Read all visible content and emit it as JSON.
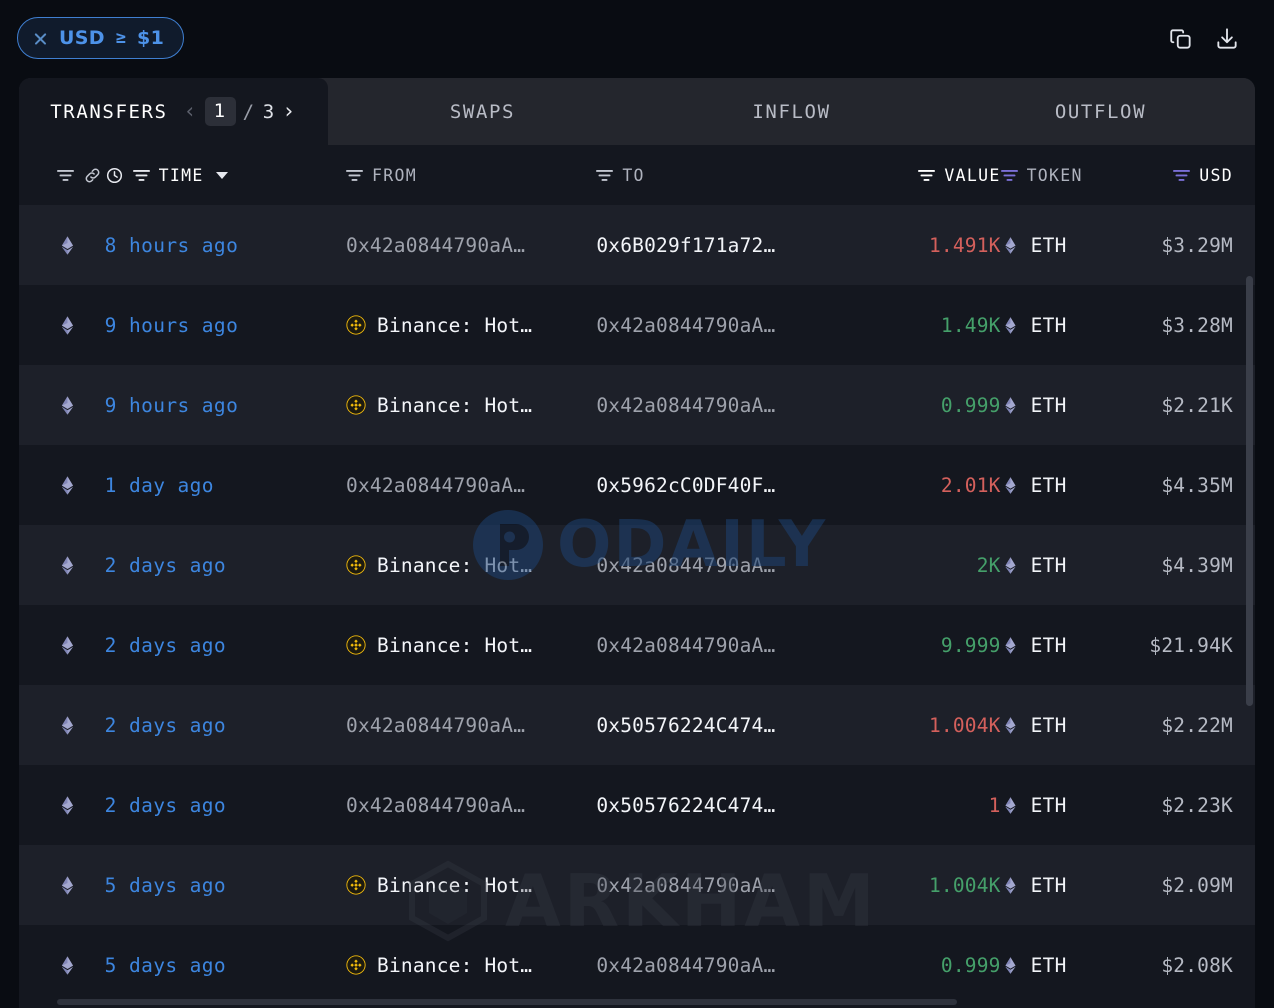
{
  "filter_chip": {
    "close_icon": "close-icon",
    "field": "USD",
    "operator": "≥",
    "value": "$1"
  },
  "toolbar": {
    "copy_icon": "copy-icon",
    "download_icon": "download-icon"
  },
  "tabs": [
    {
      "label": "TRANSFERS",
      "active": true
    },
    {
      "label": "SWAPS",
      "active": false
    },
    {
      "label": "INFLOW",
      "active": false
    },
    {
      "label": "OUTFLOW",
      "active": false
    }
  ],
  "pagination": {
    "prev_icon": "chevron-left-icon",
    "current": "1",
    "separator": "/",
    "total": "3",
    "next_icon": "chevron-right-icon"
  },
  "columns": {
    "chain_filter_icon": "filter-icon",
    "chain_link_icon": "link-icon",
    "time_clock_icon": "clock-icon",
    "time_filter_icon": "filter-icon",
    "time": "TIME",
    "sort_icon": "sort-desc-icon",
    "from_filter_icon": "filter-icon",
    "from": "FROM",
    "to_filter_icon": "filter-icon",
    "to": "TO",
    "value_filter_icon": "filter-icon",
    "value": "VALUE",
    "token_filter_icon": "filter-icon",
    "token": "TOKEN",
    "usd_filter_icon": "filter-icon",
    "usd": "USD"
  },
  "accent_colors": {
    "chip_blue": "#4d92e8",
    "time_blue": "#3d86e0",
    "value_negative": "#d4605c",
    "value_positive": "#45a06a",
    "filter_active_purple": "#7a6fd6",
    "binance_gold": "#f0b90b",
    "eth_purple": "#8a8fc0",
    "row_alt_bg": "#1d2029",
    "card_bg": "#14171f",
    "page_bg": "#090c12"
  },
  "watermarks": [
    {
      "name": "odaily-watermark",
      "text": "ODAILY"
    },
    {
      "name": "arkham-watermark",
      "text": "ARKHAM"
    }
  ],
  "rows": [
    {
      "chain_icon": "ethereum-icon",
      "time": "8 hours ago",
      "from": "0x42a0844790aA…",
      "from_type": "address",
      "from_style": "dim",
      "to": "0x6B029f171a72…",
      "to_type": "address",
      "to_style": "bright",
      "value": "1.491K",
      "value_dir": "neg",
      "token_icon": "ethereum-icon",
      "token": "ETH",
      "usd": "$3.29M"
    },
    {
      "chain_icon": "ethereum-icon",
      "time": "9 hours ago",
      "from": "Binance: Hot…",
      "from_type": "entity",
      "from_style": "bright",
      "to": "0x42a0844790aA…",
      "to_type": "address",
      "to_style": "dim",
      "value": "1.49K",
      "value_dir": "pos",
      "token_icon": "ethereum-icon",
      "token": "ETH",
      "usd": "$3.28M"
    },
    {
      "chain_icon": "ethereum-icon",
      "time": "9 hours ago",
      "from": "Binance: Hot…",
      "from_type": "entity",
      "from_style": "bright",
      "to": "0x42a0844790aA…",
      "to_type": "address",
      "to_style": "dim",
      "value": "0.999",
      "value_dir": "pos",
      "token_icon": "ethereum-icon",
      "token": "ETH",
      "usd": "$2.21K"
    },
    {
      "chain_icon": "ethereum-icon",
      "time": "1 day ago",
      "from": "0x42a0844790aA…",
      "from_type": "address",
      "from_style": "dim",
      "to": "0x5962cC0DF40F…",
      "to_type": "address",
      "to_style": "bright",
      "value": "2.01K",
      "value_dir": "neg",
      "token_icon": "ethereum-icon",
      "token": "ETH",
      "usd": "$4.35M"
    },
    {
      "chain_icon": "ethereum-icon",
      "time": "2 days ago",
      "from": "Binance: Hot…",
      "from_type": "entity",
      "from_style": "bright",
      "to": "0x42a0844790aA…",
      "to_type": "address",
      "to_style": "dim",
      "value": "2K",
      "value_dir": "pos",
      "token_icon": "ethereum-icon",
      "token": "ETH",
      "usd": "$4.39M"
    },
    {
      "chain_icon": "ethereum-icon",
      "time": "2 days ago",
      "from": "Binance: Hot…",
      "from_type": "entity",
      "from_style": "bright",
      "to": "0x42a0844790aA…",
      "to_type": "address",
      "to_style": "dim",
      "value": "9.999",
      "value_dir": "pos",
      "token_icon": "ethereum-icon",
      "token": "ETH",
      "usd": "$21.94K"
    },
    {
      "chain_icon": "ethereum-icon",
      "time": "2 days ago",
      "from": "0x42a0844790aA…",
      "from_type": "address",
      "from_style": "dim",
      "to": "0x50576224C474…",
      "to_type": "address",
      "to_style": "bright",
      "value": "1.004K",
      "value_dir": "neg",
      "token_icon": "ethereum-icon",
      "token": "ETH",
      "usd": "$2.22M"
    },
    {
      "chain_icon": "ethereum-icon",
      "time": "2 days ago",
      "from": "0x42a0844790aA…",
      "from_type": "address",
      "from_style": "dim",
      "to": "0x50576224C474…",
      "to_type": "address",
      "to_style": "bright",
      "value": "1",
      "value_dir": "neg",
      "token_icon": "ethereum-icon",
      "token": "ETH",
      "usd": "$2.23K"
    },
    {
      "chain_icon": "ethereum-icon",
      "time": "5 days ago",
      "from": "Binance: Hot…",
      "from_type": "entity",
      "from_style": "bright",
      "to": "0x42a0844790aA…",
      "to_type": "address",
      "to_style": "dim",
      "value": "1.004K",
      "value_dir": "pos",
      "token_icon": "ethereum-icon",
      "token": "ETH",
      "usd": "$2.09M"
    },
    {
      "chain_icon": "ethereum-icon",
      "time": "5 days ago",
      "from": "Binance: Hot…",
      "from_type": "entity",
      "from_style": "bright",
      "to": "0x42a0844790aA…",
      "to_type": "address",
      "to_style": "dim",
      "value": "0.999",
      "value_dir": "pos",
      "token_icon": "ethereum-icon",
      "token": "ETH",
      "usd": "$2.08K"
    }
  ]
}
